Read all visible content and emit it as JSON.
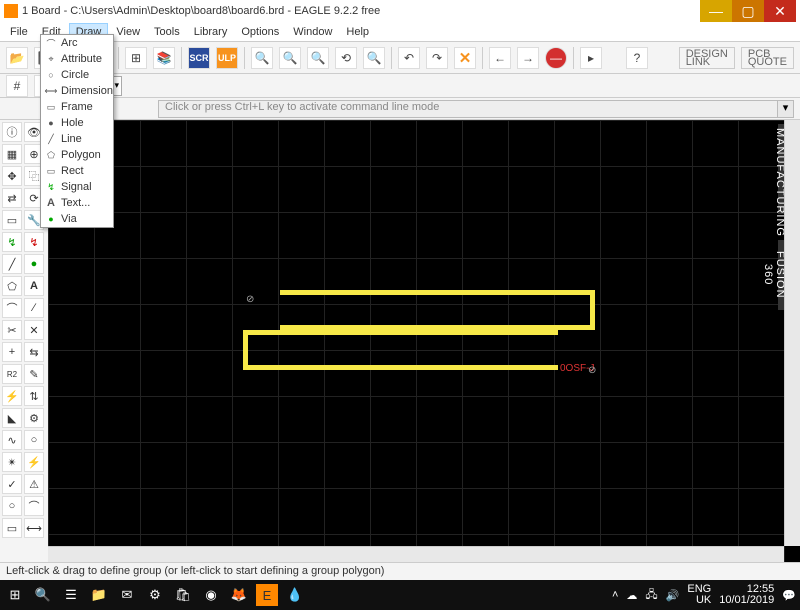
{
  "title": "1 Board - C:\\Users\\Admin\\Desktop\\board8\\board6.brd - EAGLE 9.2.2 free",
  "menubar": [
    "File",
    "Edit",
    "Draw",
    "View",
    "Tools",
    "Library",
    "Options",
    "Window",
    "Help"
  ],
  "open_menu_index": 2,
  "draw_menu": [
    "Arc",
    "Attribute",
    "Circle",
    "Dimension",
    "Frame",
    "Hole",
    "Line",
    "Polygon",
    "Rect",
    "Signal",
    "Text...",
    "Via"
  ],
  "cmd_placeholder": "Click or press Ctrl+L key to activate command line mode",
  "status": "Left-click & drag to define group (or left-click to start defining a group polygon)",
  "design_link": "DESIGN\nLINK",
  "pcb_quote": "PCB\nQUOTE",
  "sidetabs": {
    "mfg": "MANUFACTURING",
    "f360": "FUSION 360"
  },
  "canvas_label": "0OSF-J",
  "taskbar": {
    "lang": "ENG",
    "kb": "UK",
    "time": "12:55",
    "date": "10/01/2019"
  }
}
